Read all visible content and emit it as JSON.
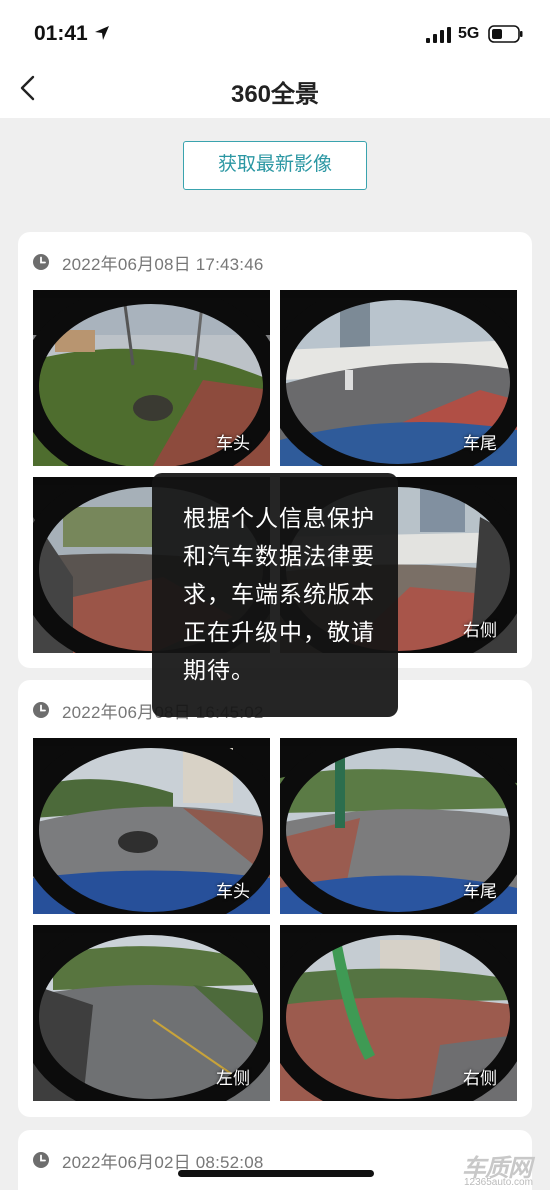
{
  "status_bar": {
    "time": "01:41",
    "network": "5G"
  },
  "nav": {
    "title": "360全景"
  },
  "refresh_button": "获取最新影像",
  "records": [
    {
      "timestamp": "2022年06月08日 17:43:46",
      "views": [
        {
          "label": "车头"
        },
        {
          "label": "车尾"
        },
        {
          "label": ""
        },
        {
          "label": "右侧"
        }
      ]
    },
    {
      "timestamp": "2022年06月08日 16:45:02",
      "views": [
        {
          "label": "车头"
        },
        {
          "label": "车尾"
        },
        {
          "label": "左侧"
        },
        {
          "label": "右侧"
        }
      ]
    },
    {
      "timestamp": "2022年06月02日 08:52:08"
    }
  ],
  "toast": {
    "message": "根据个人信息保护和汽车数据法律要求，车端系统版本正在升级中，敬请期待。"
  },
  "watermark": {
    "main": "车质网",
    "sub": "12365auto.com"
  },
  "colors": {
    "accent": "#3aa3ae",
    "background": "#efefef",
    "card": "#ffffff"
  }
}
